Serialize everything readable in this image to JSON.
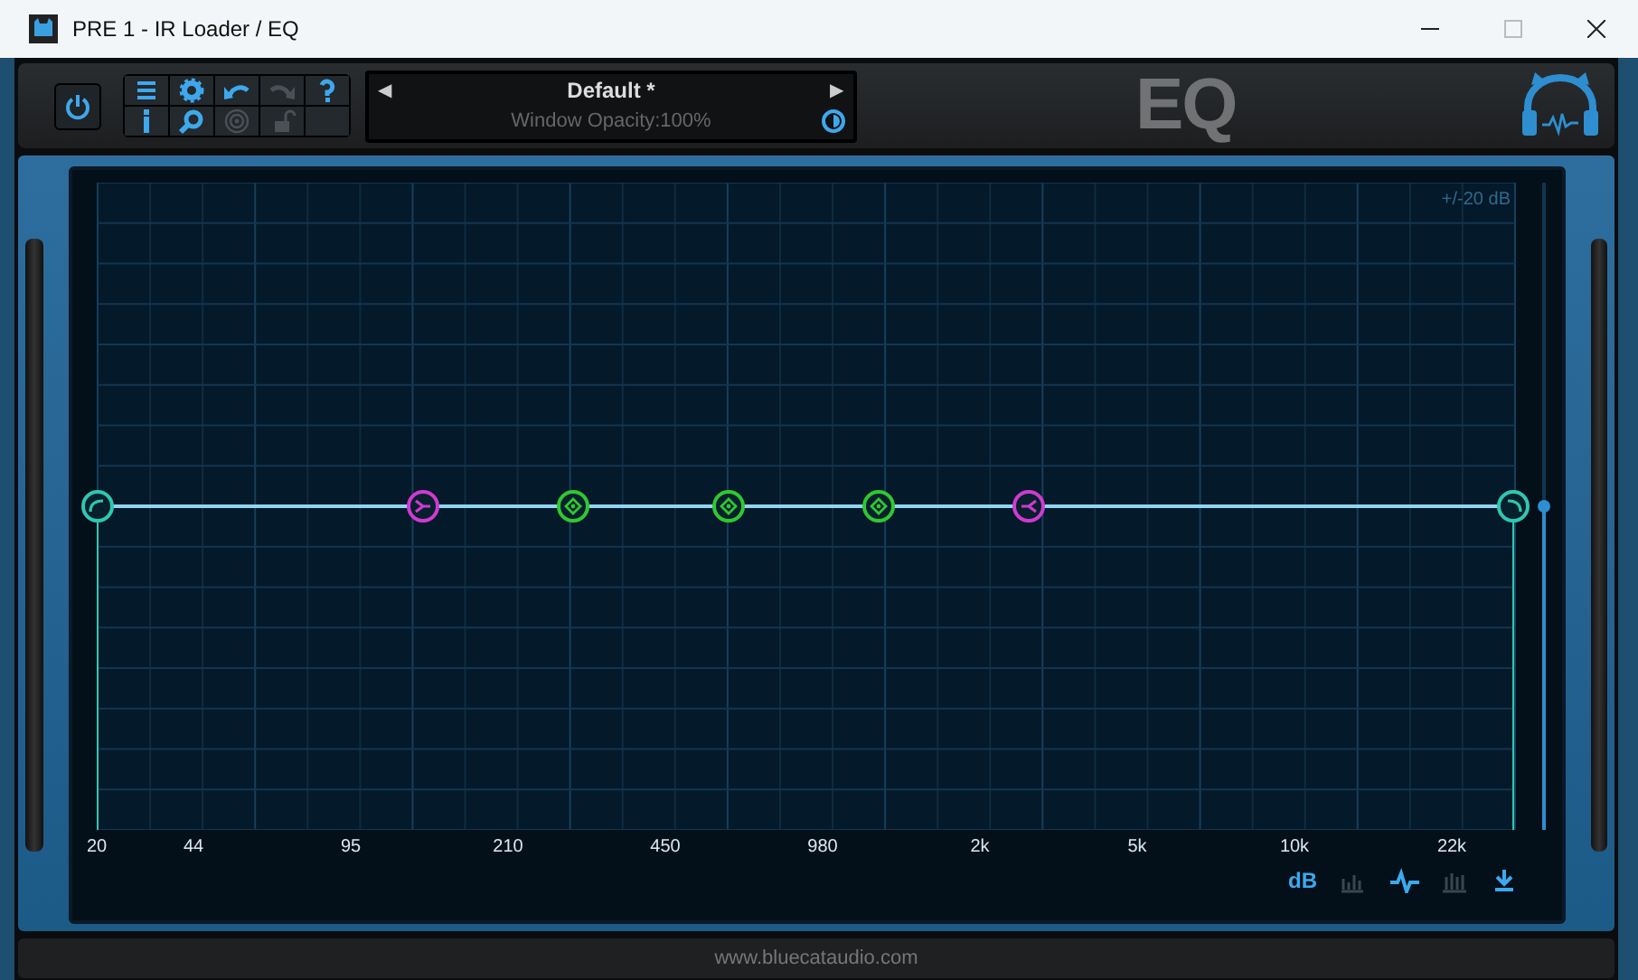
{
  "window": {
    "title": "PRE 1 - IR Loader / EQ",
    "controls": [
      {
        "kind": "minimize"
      },
      {
        "kind": "maximize",
        "disabled": true
      },
      {
        "kind": "close"
      }
    ]
  },
  "power": {
    "on": true
  },
  "toolbar": [
    {
      "kind": "menu",
      "disabled": false
    },
    {
      "kind": "settings",
      "disabled": false
    },
    {
      "kind": "undo",
      "disabled": false
    },
    {
      "kind": "redo",
      "disabled": true
    },
    {
      "kind": "help",
      "disabled": false
    },
    {
      "kind": "info",
      "disabled": false
    },
    {
      "kind": "search",
      "disabled": false
    },
    {
      "kind": "target",
      "disabled": true
    },
    {
      "kind": "lock",
      "disabled": true
    },
    {
      "kind": "blank"
    }
  ],
  "preset": {
    "prev": "◀",
    "name": "Default *",
    "next": "▶",
    "status": "Window Opacity:100%"
  },
  "logo": "EQ",
  "graph": {
    "range": "+/-20 dB",
    "x_labels": [
      "20",
      "44",
      "95",
      "210",
      "450",
      "980",
      "2k",
      "5k",
      "10k",
      "22k"
    ],
    "bands": [
      {
        "kind": "lowcut",
        "color": "#2ec8b0"
      },
      {
        "kind": "lowshelf",
        "color": "#d03ad0"
      },
      {
        "kind": "peak",
        "color": "#30c830"
      },
      {
        "kind": "peak",
        "color": "#30c830"
      },
      {
        "kind": "peak",
        "color": "#30c830"
      },
      {
        "kind": "highshelf",
        "color": "#d03ad0"
      },
      {
        "kind": "highcut",
        "color": "#2ec8b0"
      }
    ],
    "gain": {
      "level": 0.5
    }
  },
  "view_buttons": [
    {
      "kind": "db",
      "label": "dB",
      "selected": true
    },
    {
      "kind": "bars",
      "selected": false
    },
    {
      "kind": "wave",
      "selected": true
    },
    {
      "kind": "bars2",
      "selected": false
    },
    {
      "kind": "download",
      "selected": true
    }
  ],
  "footer": "www.bluecataudio.com"
}
